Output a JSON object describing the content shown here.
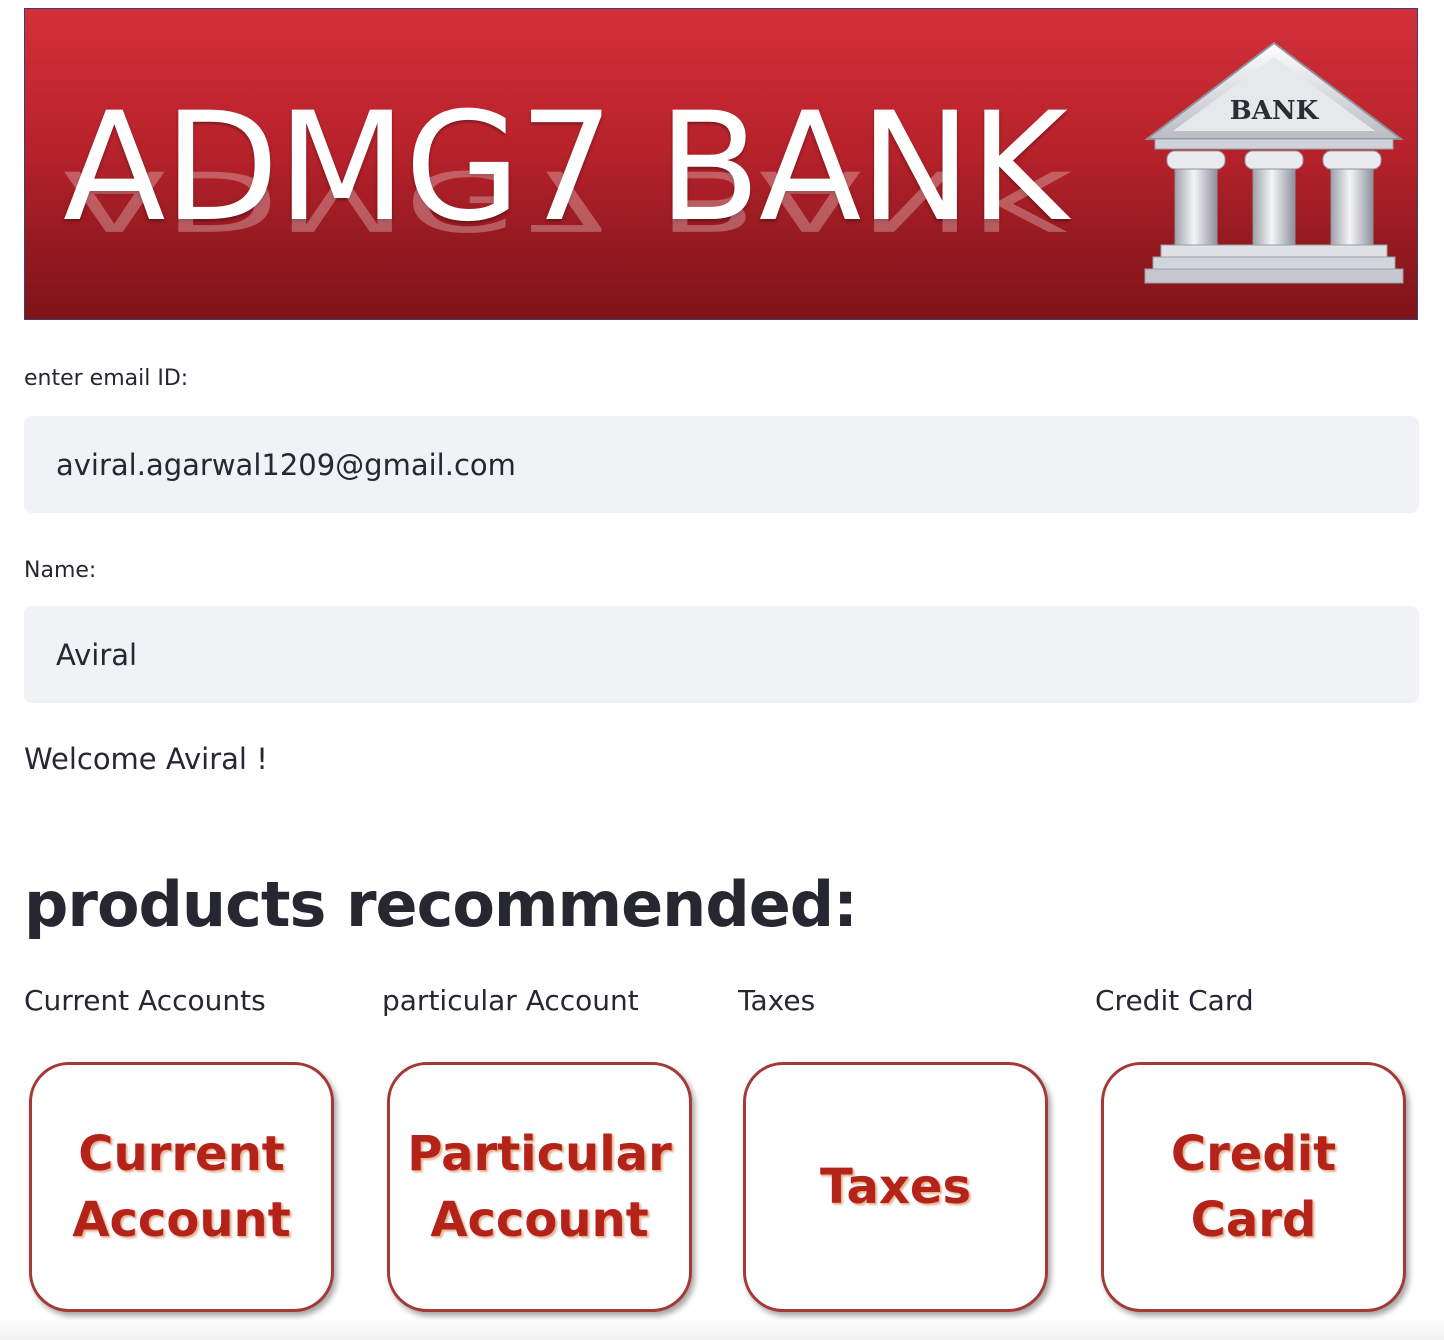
{
  "banner": {
    "title": "ADMG7 BANK",
    "logo_text": "BANK"
  },
  "form": {
    "email_label": "enter email ID:",
    "email_value": "aviral.agarwal1209@gmail.com",
    "name_label": "Name:",
    "name_value": "Aviral"
  },
  "welcome_text": "Welcome Aviral !",
  "products": {
    "heading": "products recommended:",
    "items": [
      {
        "label": "Current Accounts",
        "card_line1": "Current",
        "card_line2": "Account"
      },
      {
        "label": "particular Account",
        "card_line1": "Particular",
        "card_line2": "Account"
      },
      {
        "label": "Taxes",
        "card_line1": "Taxes",
        "card_line2": ""
      },
      {
        "label": "Credit Card",
        "card_line1": "Credit",
        "card_line2": "Card"
      }
    ]
  },
  "colors": {
    "banner_red": "#b8222b",
    "card_text_red": "#b4231a",
    "input_bg": "#f0f2f6",
    "text": "#262730"
  }
}
